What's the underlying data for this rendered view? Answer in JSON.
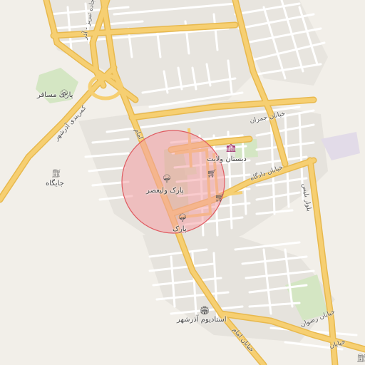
{
  "map": {
    "colors": {
      "background": "#f2efe9",
      "residential": "#e6e3dd",
      "park": "#d4e6c3",
      "major_road": "#f6cf72",
      "minor_road": "#ffffff",
      "highlight_fill": "#f4a0a4",
      "highlight_stroke": "#e05a60",
      "school": "#e2dbe8"
    },
    "labels": {
      "park_mosafer": "پارک مسافر",
      "gas_station": "جایگاه",
      "park_valiasr": "پارک ولیعصر",
      "park": "پارک",
      "school_velayat": "دبستان ولایت",
      "stadium": "استادیوم آذرشهر",
      "jamran_street": "خیابان جمران",
      "dadgah_street": "خیابان دادگاه",
      "tabriz_road": "جاده تبریز - آذر",
      "kamarbandi_road": "کمربندی آذرشهر",
      "imam_north": "امام",
      "imam_street": "خیابان امام",
      "rezvan_street": "خیابان رضوان",
      "bolvar": "بلوار بلیس",
      "khiaban_short": "خیابان"
    },
    "icons": {
      "park": "tree-icon",
      "gas": "fuel-icon",
      "shop": "cart-icon",
      "school": "school-icon",
      "stadium": "stadium-icon"
    }
  }
}
